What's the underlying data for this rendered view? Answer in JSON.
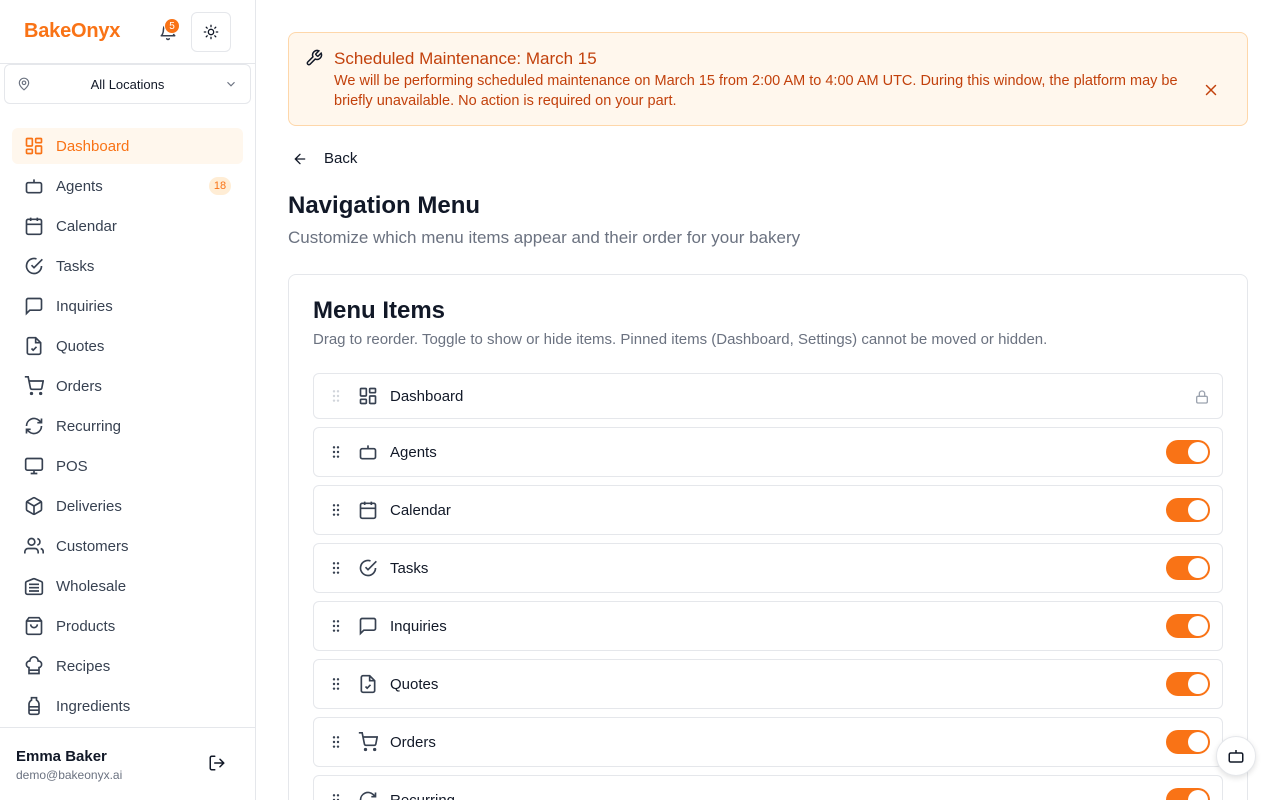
{
  "brand": "BakeOnyx",
  "notifications": {
    "count": "5"
  },
  "location": {
    "selected": "All Locations"
  },
  "sidebar": {
    "items": [
      {
        "label": "Dashboard",
        "icon": "dashboard-icon",
        "active": true
      },
      {
        "label": "Agents",
        "icon": "bot-icon",
        "count": "18"
      },
      {
        "label": "Calendar",
        "icon": "calendar-icon"
      },
      {
        "label": "Tasks",
        "icon": "check-circle-icon"
      },
      {
        "label": "Inquiries",
        "icon": "message-icon"
      },
      {
        "label": "Quotes",
        "icon": "file-check-icon"
      },
      {
        "label": "Orders",
        "icon": "cart-icon"
      },
      {
        "label": "Recurring",
        "icon": "refresh-icon"
      },
      {
        "label": "POS",
        "icon": "monitor-icon"
      },
      {
        "label": "Deliveries",
        "icon": "package-icon"
      },
      {
        "label": "Customers",
        "icon": "users-icon"
      },
      {
        "label": "Wholesale",
        "icon": "warehouse-icon"
      },
      {
        "label": "Products",
        "icon": "shopping-bag-icon"
      },
      {
        "label": "Recipes",
        "icon": "chef-hat-icon"
      },
      {
        "label": "Ingredients",
        "icon": "ingredients-icon"
      }
    ]
  },
  "user": {
    "name": "Emma Baker",
    "email": "demo@bakeonyx.ai"
  },
  "alert": {
    "title": "Scheduled Maintenance: March 15",
    "body": "We will be performing scheduled maintenance on March 15 from 2:00 AM to 4:00 AM UTC. During this window, the platform may be briefly unavailable. No action is required on your part."
  },
  "back_label": "Back",
  "page": {
    "title": "Navigation Menu",
    "subtitle": "Customize which menu items appear and their order for your bakery"
  },
  "card": {
    "title": "Menu Items",
    "description": "Drag to reorder. Toggle to show or hide items. Pinned items (Dashboard, Settings) cannot be moved or hidden."
  },
  "menu_items": [
    {
      "label": "Dashboard",
      "icon": "dashboard-icon",
      "pinned": true
    },
    {
      "label": "Agents",
      "icon": "bot-icon",
      "visible": true
    },
    {
      "label": "Calendar",
      "icon": "calendar-icon",
      "visible": true
    },
    {
      "label": "Tasks",
      "icon": "check-circle-icon",
      "visible": true
    },
    {
      "label": "Inquiries",
      "icon": "message-icon",
      "visible": true
    },
    {
      "label": "Quotes",
      "icon": "file-check-icon",
      "visible": true
    },
    {
      "label": "Orders",
      "icon": "cart-icon",
      "visible": true
    },
    {
      "label": "Recurring",
      "icon": "refresh-icon",
      "visible": true
    }
  ],
  "colors": {
    "accent": "#f97316",
    "alert_bg": "#fff7ed",
    "alert_text": "#c2410c"
  }
}
